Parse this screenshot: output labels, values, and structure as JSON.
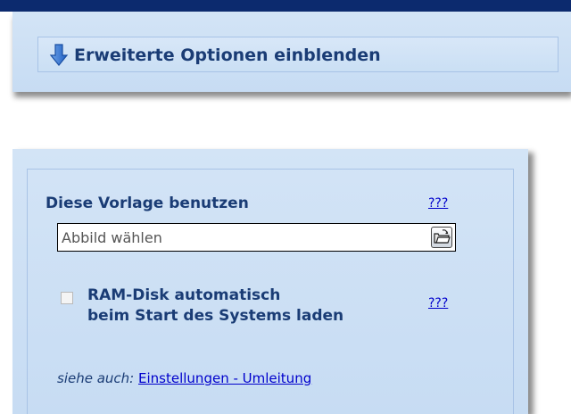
{
  "expand": {
    "label": "Erweiterte Optionen einblenden",
    "arrow_icon": "arrow-down-icon"
  },
  "template": {
    "title": "Diese Vorlage benutzen",
    "help_label": "???",
    "image_placeholder": "Abbild wählen",
    "image_value": "",
    "browse_icon": "open-folder-icon"
  },
  "ramdisk": {
    "checked": false,
    "label_line1": "RAM-Disk automatisch",
    "label_line2": "beim Start des Systems laden",
    "help_label": "???"
  },
  "see_also": {
    "prefix": "siehe auch:",
    "link_label": "Einstellungen - Umleitung"
  },
  "colors": {
    "panel_bg": "#cfe1f5",
    "title_text": "#1a3c75",
    "link": "#0000cc",
    "top_bar": "#0c2a6e"
  }
}
